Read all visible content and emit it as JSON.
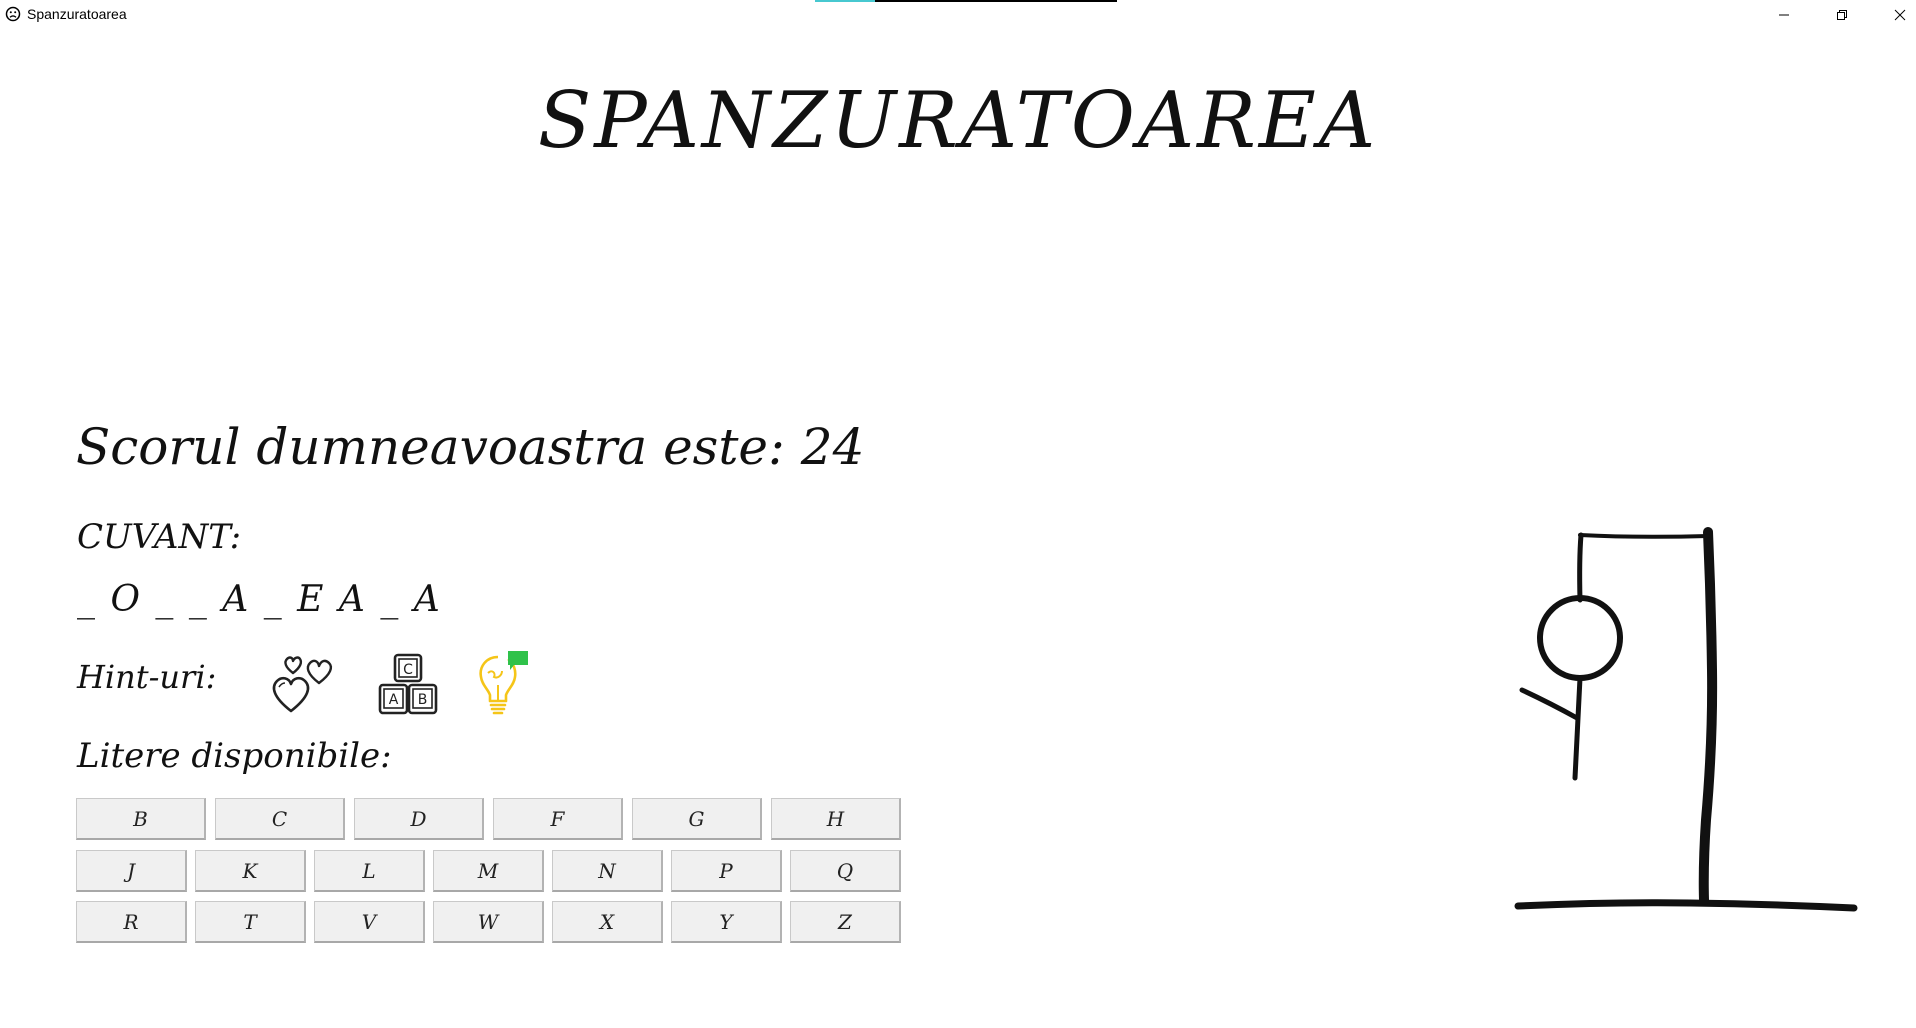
{
  "window": {
    "title": "Spanzuratoarea",
    "app_icon": "sad-face-icon",
    "controls": [
      "minimize-icon",
      "restore-icon",
      "close-icon"
    ]
  },
  "game": {
    "title": "SPANZURATOAREA",
    "score_text": "Scorul dumneavoastra este: 24",
    "word_label": "CUVANT:",
    "word_display": "_ O _ _ A _ E A _ A",
    "hints_label": "Hint-uri:",
    "hints": [
      {
        "icon": "hearts-icon"
      },
      {
        "icon": "letter-blocks-icon"
      },
      {
        "icon": "lightbulb-icon"
      }
    ],
    "letters_label": "Litere disponibile:",
    "letters": {
      "row1": [
        "B",
        "C",
        "D",
        "F",
        "G",
        "H"
      ],
      "row2": [
        "J",
        "K",
        "L",
        "M",
        "N",
        "P",
        "Q"
      ],
      "row3": [
        "R",
        "T",
        "V",
        "W",
        "X",
        "Y",
        "Z"
      ]
    }
  },
  "colors": {
    "accent_strip": "#47c8d0",
    "bulb": "#f5c518",
    "bulb_badge": "#2fc24a"
  }
}
